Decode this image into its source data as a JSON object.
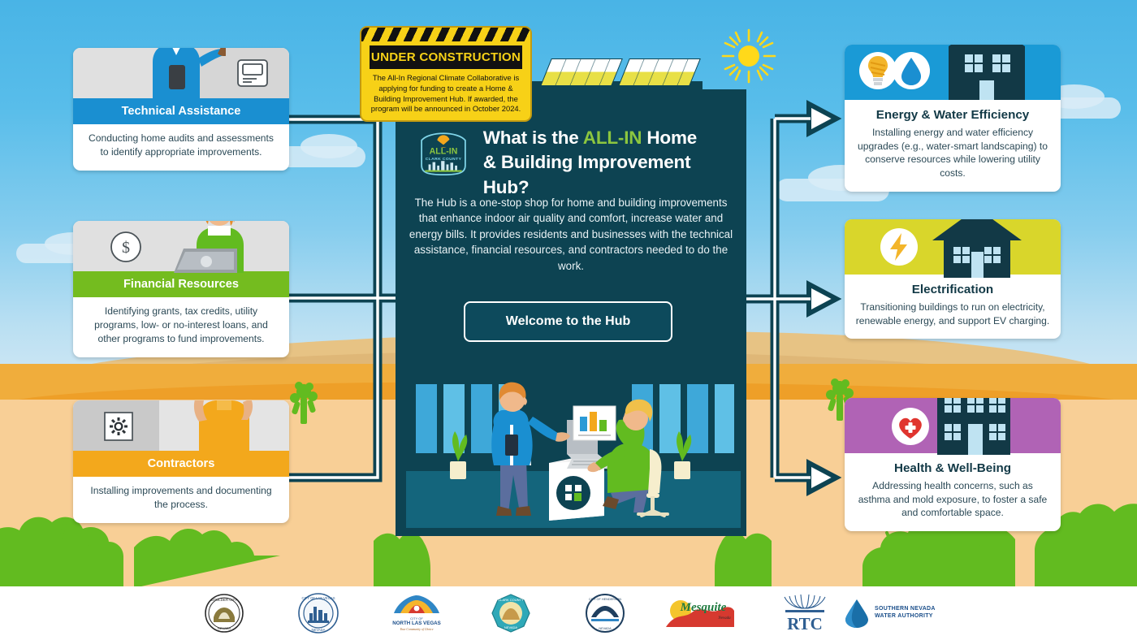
{
  "under_construction": {
    "title": "UNDER CONSTRUCTION",
    "body": "The All-In Regional Climate Collaborative is applying for funding to create a Home & Building Improvement Hub. If awarded, the program will be announced in October 2024."
  },
  "hub": {
    "logo_line1": "ALL-IN",
    "logo_line2": "CLARK COUNTY",
    "title_part1": "What is the ",
    "title_highlight": "ALL-IN",
    "title_part2": " Home",
    "title_line2": "& Building Improvement Hub?",
    "body": "The Hub is a one-stop shop for home and building improvements that enhance indoor air quality and comfort, increase water and energy bills. It provides residents and businesses with the technical assistance, financial resources, and contractors needed to do the work.",
    "button_label": "Welcome to the Hub",
    "accent_green": "#8cc63f",
    "panel_color": "#0d4352"
  },
  "left_cards": [
    {
      "title": "Technical Assistance",
      "desc": "Conducting home audits and assessments to identify appropriate improvements.",
      "band_color": "#1a8fd1",
      "icon": "monitor-icon",
      "art": "technical-assistance-illustration"
    },
    {
      "title": "Financial Resources",
      "desc": "Identifying grants, tax credits, utility programs, low- or no-interest loans, and other programs to fund improvements.",
      "band_color": "#74bc1f",
      "icon": "dollar-coin-icon",
      "art": "financial-resources-illustration"
    },
    {
      "title": "Contractors",
      "desc": "Installing improvements and documenting the process.",
      "band_color": "#f3a81c",
      "icon": "gear-icon",
      "art": "contractor-illustration"
    }
  ],
  "right_cards": [
    {
      "title": "Energy & Water Efficiency",
      "desc": "Installing energy and water efficiency upgrades (e.g., water-smart landscaping) to conserve resources while lowering utility costs.",
      "band_color": "#1a9ad6",
      "icons": [
        "lightbulb-icon",
        "water-drop-icon"
      ],
      "art": "house-icon"
    },
    {
      "title": "Electrification",
      "desc": "Transitioning buildings to run on electricity, renewable energy, and support EV charging.",
      "band_color": "#d9d62b",
      "icons": [
        "lightning-bolt-icon"
      ],
      "art": "house-icon"
    },
    {
      "title": "Health & Well-Being",
      "desc": "Addressing health concerns, such as asthma and mold exposure, to foster a safe and comfortable space.",
      "band_color": "#b濁"
    }
  ],
  "right_cards_fixed": [
    {
      "title": "Energy & Water Efficiency",
      "desc": "Installing energy and water efficiency upgrades (e.g., water-smart landscaping) to conserve resources while lowering utility costs.",
      "band_color": "#1a9ad6"
    },
    {
      "title": "Electrification",
      "desc": "Transitioning buildings to run on electricity, renewable energy, and support EV charging.",
      "band_color": "#d9d62b"
    },
    {
      "title": "Health & Well-Being",
      "desc": "Addressing health concerns, such as asthma and mold exposure, to foster a safe and comfortable space.",
      "band_color": "#b濁"
    }
  ],
  "footer_logos": [
    {
      "name": "Boulder City Nevada",
      "label": "BOULDER CITY NEVADA"
    },
    {
      "name": "City of Las Vegas Nevada",
      "label": "CITY OF LAS VEGAS NEVADA"
    },
    {
      "name": "City of North Las Vegas",
      "label": "CITY OF NORTH LAS VEGAS"
    },
    {
      "name": "Clark County Nevada",
      "label": "CLARK COUNTY NEVADA"
    },
    {
      "name": "City of Henderson",
      "label": "CITY OF HENDERSON"
    },
    {
      "name": "Mesquite Nevada",
      "label": "Mesquite"
    },
    {
      "name": "RTC",
      "label": "RTC"
    },
    {
      "name": "Southern Nevada Water Authority",
      "label_line1": "SOUTHERN NEVADA",
      "label_line2": "WATER AUTHORITY"
    }
  ]
}
